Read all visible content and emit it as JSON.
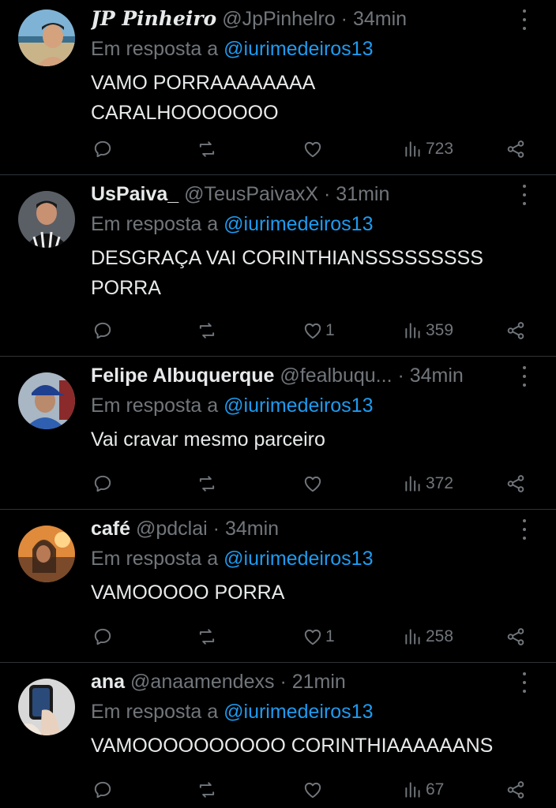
{
  "replying_prefix": "Em resposta a",
  "separator": "·",
  "tweets": [
    {
      "name": "JP Pinheiro",
      "handle": "@JpPinhelro",
      "time": "34min",
      "mention": "@iurimedeiros13",
      "text": "VAMO PORRAAAAAAAA\nCARALHOOOOOOO",
      "likes": "",
      "views": "723",
      "avatar": "beach-photo"
    },
    {
      "name": "UsPaiva_",
      "handle": "@TeusPaivaxX",
      "time": "31min",
      "mention": "@iurimedeiros13",
      "text": "DESGRAÇA VAI CORINTHIANSSSSSSSSS\nPORRA",
      "likes": "1",
      "views": "359",
      "avatar": "jersey-photo"
    },
    {
      "name": "Felipe Albuquerque",
      "handle": "@fealbuqu...",
      "time": "34min",
      "mention": "@iurimedeiros13",
      "text": "Vai cravar mesmo parceiro",
      "likes": "",
      "views": "372",
      "avatar": "cap-photo"
    },
    {
      "name": "café",
      "handle": "@pdclai",
      "time": "34min",
      "mention": "@iurimedeiros13",
      "text": "VAMOOOOO PORRA",
      "likes": "1",
      "views": "258",
      "avatar": "sunset-photo"
    },
    {
      "name": "ana",
      "handle": "@anaamendexs",
      "time": "21min",
      "mention": "@iurimedeiros13",
      "text": "VAMOOOOOOOOOO CORINTHIAAAAAANS",
      "likes": "",
      "views": "67",
      "avatar": "mirror-selfie-photo"
    }
  ]
}
